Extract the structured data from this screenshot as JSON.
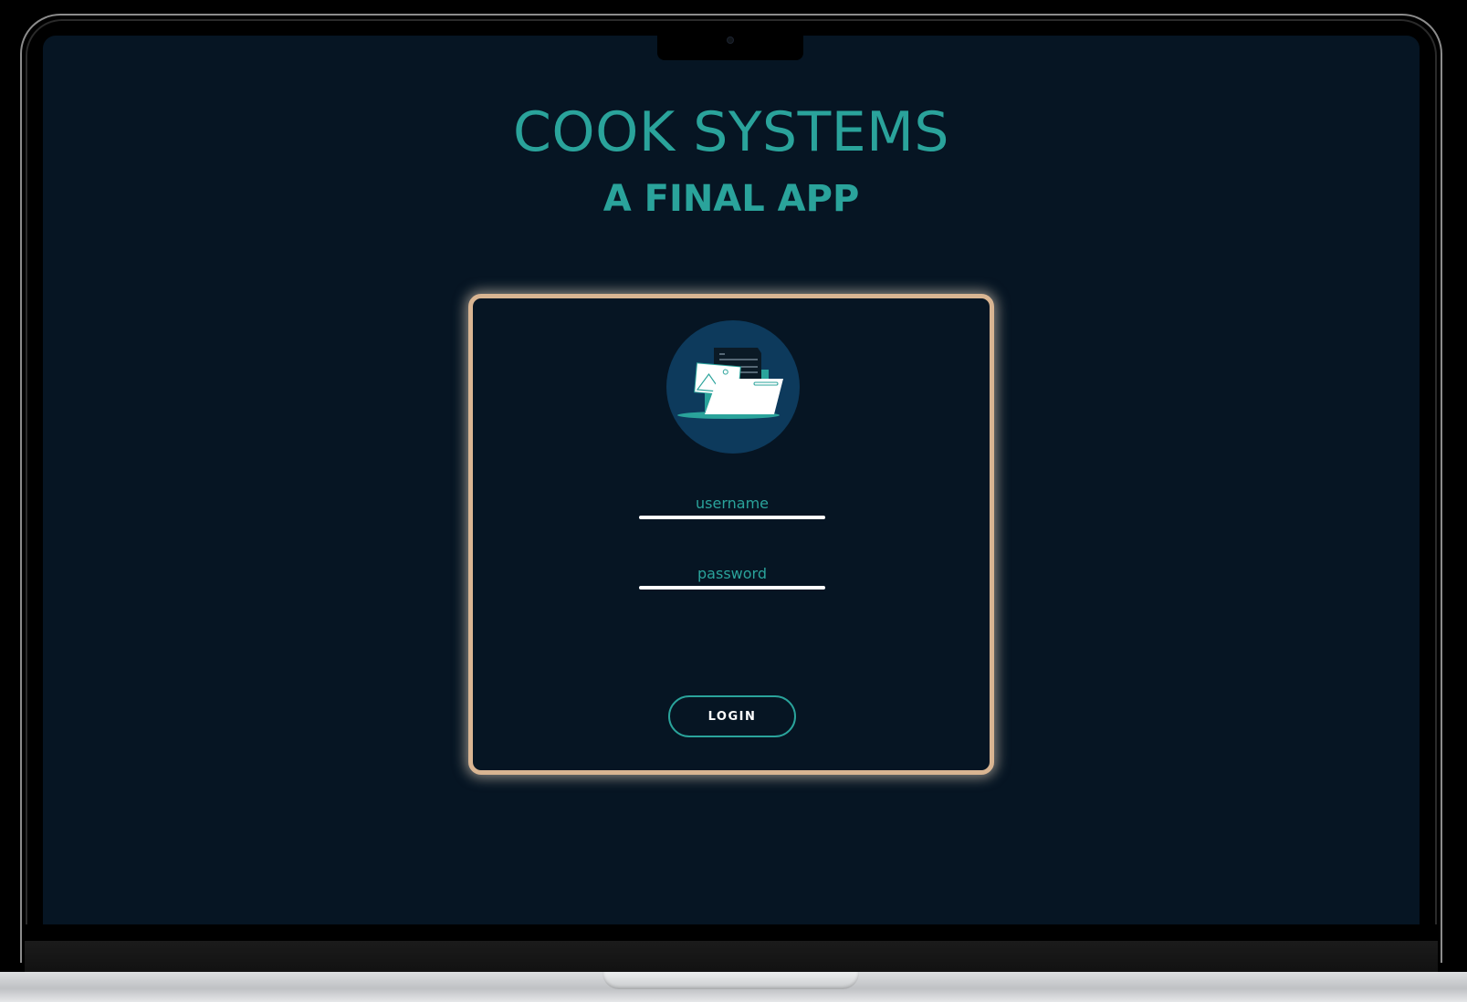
{
  "app": {
    "title": "COOK SYSTEMS",
    "subtitle": "A FINAL APP"
  },
  "login": {
    "logo_icon": "folder-documents-icon",
    "username_placeholder": "username",
    "username_value": "",
    "password_placeholder": "password",
    "password_value": "",
    "button_label": "LOGIN"
  },
  "colors": {
    "background": "#061523",
    "accent": "#2aa39b",
    "card_border": "#d9b592",
    "logo_circle": "#0d3a5c",
    "input_underline": "#ffffff"
  }
}
